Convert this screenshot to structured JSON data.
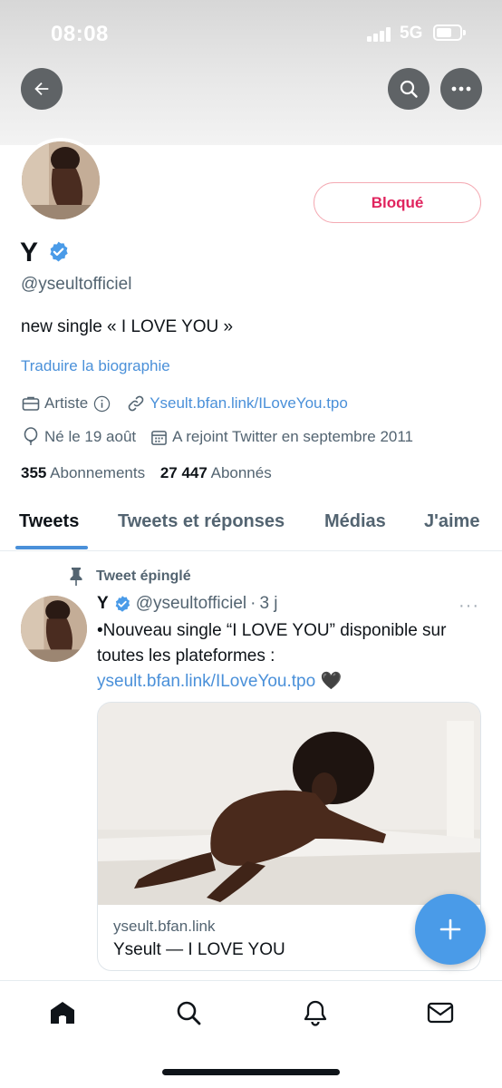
{
  "status_bar": {
    "time": "08:08",
    "network": "5G"
  },
  "header": {
    "back_icon": "arrow-left-icon",
    "search_icon": "search-icon",
    "more_icon": "ellipsis-icon"
  },
  "profile": {
    "blocked_label": "Bloqué",
    "display_name": "Y",
    "verified": true,
    "handle": "@yseultofficiel",
    "bio": "new single « I LOVE YOU »",
    "translate_label": "Traduire la biographie",
    "category": "Artiste",
    "link": "Yseult.bfan.link/ILoveYou.tpo",
    "birthday": "Né le 19 août",
    "joined": "A rejoint Twitter en septembre 2011",
    "following_count": "355",
    "following_label": "Abonnements",
    "followers_count": "27 447",
    "followers_label": "Abonnés"
  },
  "tabs": [
    {
      "label": "Tweets",
      "active": true
    },
    {
      "label": "Tweets et réponses",
      "active": false
    },
    {
      "label": "Médias",
      "active": false
    },
    {
      "label": "J'aime",
      "active": false
    }
  ],
  "tweet": {
    "pinned_label": "Tweet épinglé",
    "name": "Y",
    "handle": "@yseultofficiel",
    "separator": "·",
    "time": "3 j",
    "more": "···",
    "text_before": "•Nouveau single “I LOVE YOU” disponible sur toutes les plateformes : ",
    "text_link": "yseult.bfan.link/ILoveYou.tpo",
    "text_after": " 🖤",
    "card": {
      "domain": "yseult.bfan.link",
      "title": "Yseult — I LOVE YOU"
    }
  },
  "fab_label": "+",
  "bottom_nav": [
    "home-icon",
    "search-icon",
    "notifications-bell-icon",
    "messages-envelope-icon"
  ],
  "colors": {
    "accent": "#4a90d9",
    "blocked": "#e0245e",
    "fab": "#4a9be8",
    "text": "#0f1419",
    "secondary": "#536471"
  }
}
